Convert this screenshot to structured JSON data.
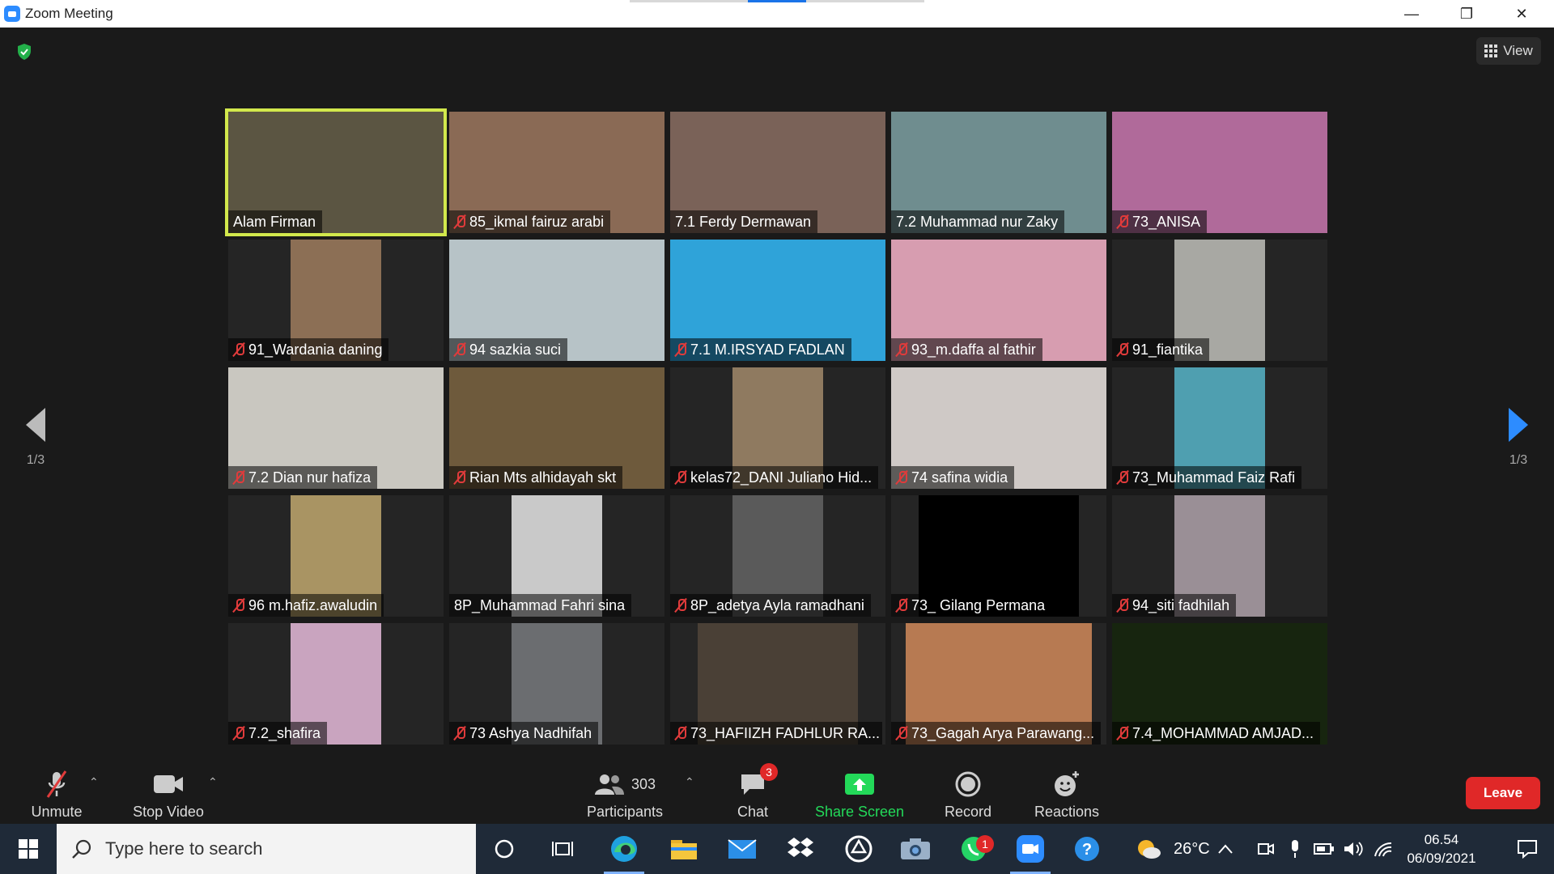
{
  "window": {
    "title": "Zoom Meeting",
    "minimize_icon": "minimize-icon",
    "restore_icon": "restore-icon",
    "close_icon": "close-icon"
  },
  "meeting": {
    "security_icon": "shield-check-icon",
    "view_label": "View",
    "page_indicator_left": "1/3",
    "page_indicator_right": "1/3",
    "active_speaker_color": "#d2e84c",
    "participants": [
      {
        "name": "Alam Firman",
        "muted": false,
        "active": true,
        "video": "#5b5542"
      },
      {
        "name": "85_ikmal fairuz arabi",
        "muted": true,
        "video": "#8a6a55"
      },
      {
        "name": "7.1 Ferdy Dermawan",
        "muted": false,
        "video": "#7a6258"
      },
      {
        "name": "7.2 Muhammad nur Zaky",
        "muted": false,
        "video": "#6f8d8f"
      },
      {
        "name": "73_ANISA",
        "muted": true,
        "video": "#b06a9a"
      },
      {
        "name": "91_Wardania daning",
        "muted": true,
        "video": "#8c6f55"
      },
      {
        "name": "94 sazkia suci",
        "muted": true,
        "video": "#b7c3c7"
      },
      {
        "name": "7.1 M.IRSYAD FADLAN",
        "muted": true,
        "video": "#2fa3d9"
      },
      {
        "name": "93_m.daffa al fathir",
        "muted": true,
        "video": "#d79db0"
      },
      {
        "name": "91_fiantika",
        "muted": true,
        "video": "#a8a8a3"
      },
      {
        "name": "7.2 Dian nur hafiza",
        "muted": true,
        "video": "#c9c7c0"
      },
      {
        "name": "Rian Mts alhidayah skt",
        "muted": true,
        "video": "#6e5a3c"
      },
      {
        "name": "kelas72_DANI Juliano Hid...",
        "muted": true,
        "video": "#8f7a60"
      },
      {
        "name": "74 safina widia",
        "muted": true,
        "video": "#cfc9c6"
      },
      {
        "name": "73_Muhammad Faiz Rafi",
        "muted": true,
        "video": "#4f9fb0"
      },
      {
        "name": "96 m.hafiz.awaludin",
        "muted": true,
        "video": "#a99463"
      },
      {
        "name": "8P_Muhammad Fahri sina",
        "muted": false,
        "video": "#c9c9c9"
      },
      {
        "name": "8P_adetya Ayla ramadhani",
        "muted": true,
        "video": "#5a5a5a"
      },
      {
        "name": "73_ Gilang Permana",
        "muted": true,
        "video": "#000000"
      },
      {
        "name": "94_siti fadhilah",
        "muted": true,
        "video": "#9a8f96"
      },
      {
        "name": "7.2_shafira",
        "muted": true,
        "video": "#c9a4bf"
      },
      {
        "name": "73 Ashya Nadhifah",
        "muted": true,
        "video": "#6b6d70"
      },
      {
        "name": "73_HAFIIZH FADHLUR RA...",
        "muted": true,
        "video": "#4a4036"
      },
      {
        "name": "73_Gagah Arya Parawang...",
        "muted": true,
        "video": "#b77a52"
      },
      {
        "name": "7.4_MOHAMMAD AMJAD...",
        "muted": true,
        "video": "#17250f"
      }
    ]
  },
  "toolbar": {
    "unmute_label": "Unmute",
    "stop_video_label": "Stop Video",
    "participants_label": "Participants",
    "participants_count": "303",
    "chat_label": "Chat",
    "chat_badge": "3",
    "share_label": "Share Screen",
    "share_color": "#23d959",
    "record_label": "Record",
    "reactions_label": "Reactions",
    "leave_label": "Leave",
    "leave_color": "#e02828"
  },
  "taskbar": {
    "search_placeholder": "Type here to search",
    "weather_temp": "26°C",
    "time": "06.54",
    "date": "06/09/2021",
    "whatsapp_badge": "1"
  }
}
